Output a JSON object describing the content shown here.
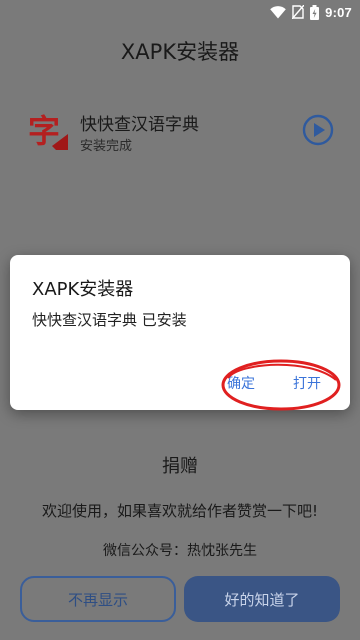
{
  "status_bar": {
    "time": "9:07",
    "icons": [
      "wifi-icon",
      "sim-icon",
      "battery-icon"
    ]
  },
  "app_title": "XAPK安装器",
  "installed_app": {
    "icon": "dictionary-app-icon",
    "icon_glyph": "字",
    "name": "快快查汉语字典",
    "status": "安装完成",
    "action_icon": "play-icon"
  },
  "dialog": {
    "title": "XAPK安装器",
    "message": "快快查汉语字典 已安装",
    "ok_label": "确定",
    "open_label": "打开"
  },
  "donate": {
    "title": "捐赠",
    "text": "欢迎使用，如果喜欢就给作者赞赏一下吧!",
    "wechat": "微信公众号：热忱张先生"
  },
  "buttons": {
    "dont_show_label": "不再显示",
    "got_it_label": "好的知道了"
  },
  "colors": {
    "accent": "#3b74d9",
    "annotation": "#e02020",
    "button_fill": "#3a5585"
  }
}
